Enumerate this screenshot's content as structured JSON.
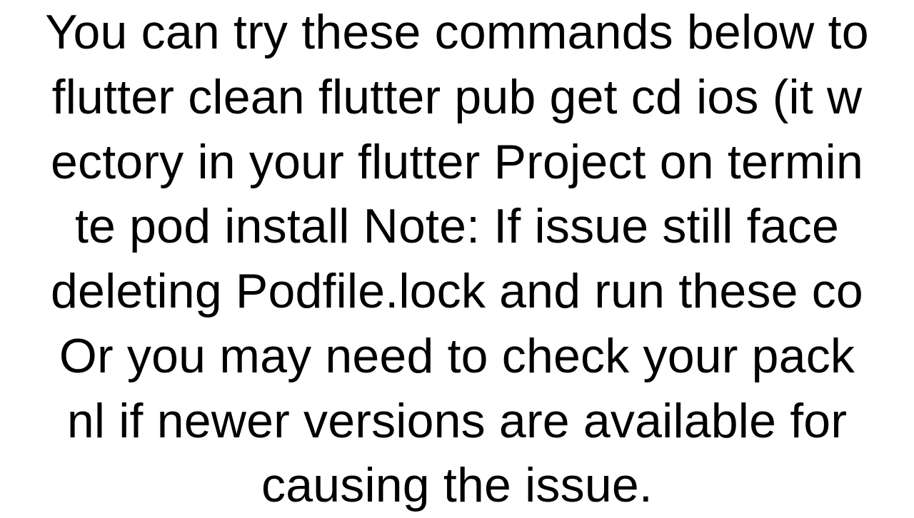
{
  "lines": [
    "You can try these commands below to",
    "flutter clean flutter pub get cd ios (it w",
    "ectory in your flutter Project on termin",
    "te pod install  Note: If issue still face ",
    "deleting Podfile.lock and run these co",
    "Or you may need to check your pack",
    "nl if newer versions are available for ",
    "causing the issue."
  ]
}
